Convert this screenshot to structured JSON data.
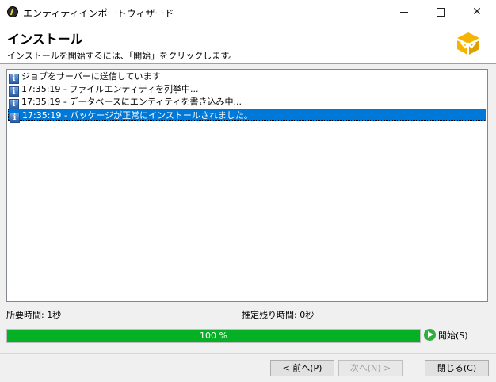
{
  "window": {
    "title": "エンティティインポートウィザード",
    "minimize_label": "",
    "close_glyph": "✕"
  },
  "header": {
    "title": "インストール",
    "subtitle": "インストールを開始するには、「開始」をクリックします。",
    "logo_icon": "package-box-icon",
    "logo_color": "#f5b400"
  },
  "log": {
    "items": [
      {
        "icon": "info-icon",
        "text": "ジョブをサーバーに送信しています",
        "selected": false
      },
      {
        "icon": "info-icon",
        "text": "17:35:19 - ファイルエンティティを列挙中...",
        "selected": false
      },
      {
        "icon": "info-icon",
        "text": "17:35:19 - データベースにエンティティを書き込み中...",
        "selected": false
      },
      {
        "icon": "info-icon",
        "text": "17:35:19 - パッケージが正常にインストールされました。",
        "selected": true
      }
    ],
    "selection_color": "#0078d7"
  },
  "status": {
    "elapsed_label": "所要時間:",
    "elapsed_value": "1秒",
    "remaining_label": "推定残り時間:",
    "remaining_value": "0秒"
  },
  "progress": {
    "value_percent": 100,
    "text": "100 %",
    "fill_color": "#06b025"
  },
  "actions": {
    "start_label": "開始(S)",
    "back_label": "< 前へ(P)",
    "next_label": "次へ(N) >",
    "close_label": "閉じる(C)"
  }
}
